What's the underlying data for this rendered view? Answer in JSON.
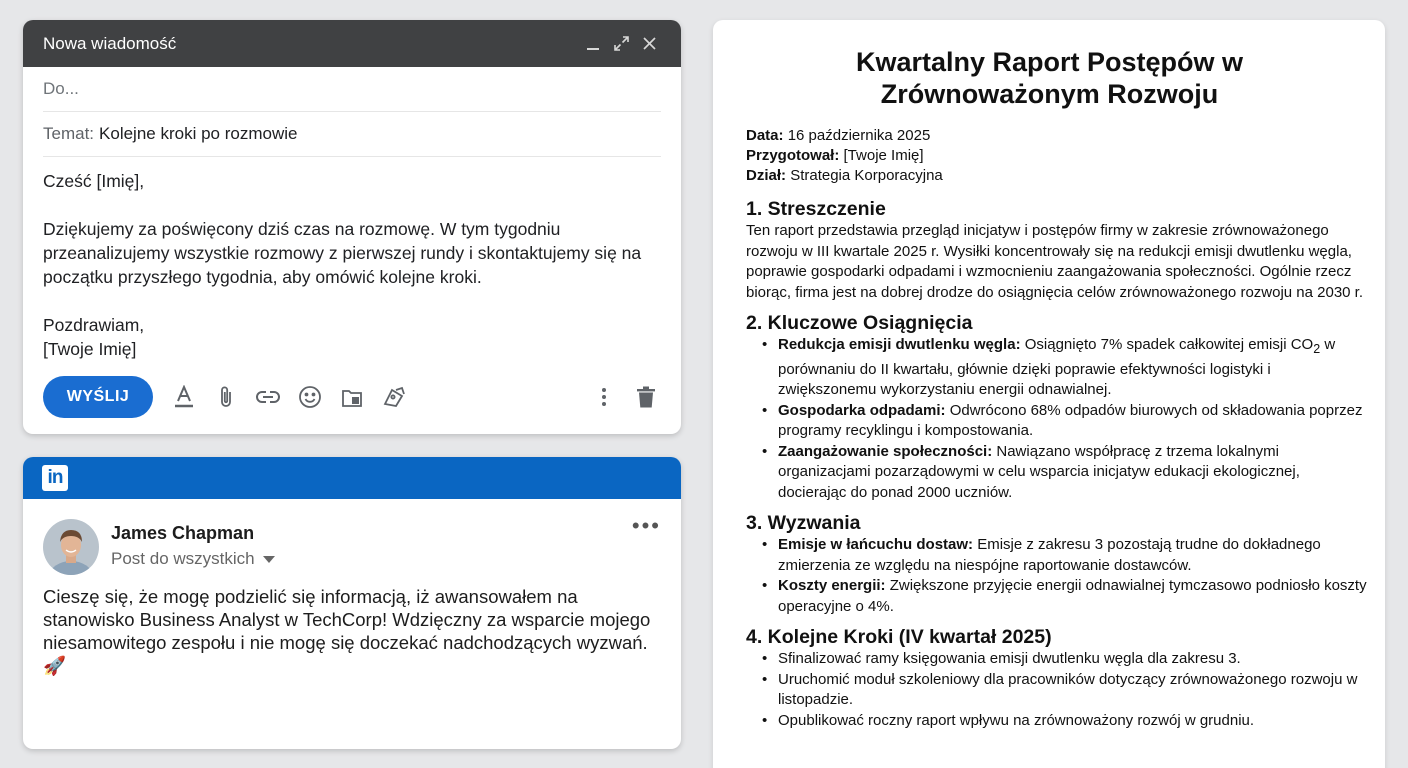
{
  "compose": {
    "title": "Nowa wiadomość",
    "to_placeholder": "Do...",
    "subject_label": "Temat:",
    "subject_value": "Kolejne kroki po rozmowie",
    "greeting": "Cześć [Imię],",
    "body": "Dziękujemy za poświęcony dziś czas na rozmowę. W tym tygodniu przeanalizujemy wszystkie rozmowy z pierwszej rundy i skontaktujemy się na początku przyszłego tygodnia, aby omówić kolejne kroki.",
    "closing": "Pozdrawiam,",
    "signature": "[Twoje Imię]",
    "send_label": "WYŚLIJ",
    "icons": [
      "format-text-icon",
      "attach-icon",
      "link-icon",
      "emoji-icon",
      "drive-icon",
      "photo-icon",
      "more-options-icon",
      "trash-icon"
    ]
  },
  "linkedin": {
    "logo": "in",
    "author": "James Chapman",
    "audience": "Post do wszystkich",
    "text": "Cieszę się, że mogę podzielić się informacją, iż awansowałem na stanowisko Business Analyst w TechCorp! Wdzięczny za wsparcie mojego niesamowitego zespołu i nie mogę się doczekać nadchodzących wyzwań. 🚀",
    "brand_color": "#0a66c2"
  },
  "report": {
    "title": "Kwartalny Raport Postępów w Zrównoważonym Rozwoju",
    "meta": [
      {
        "label": "Data:",
        "value": "16 października 2025"
      },
      {
        "label": "Przygotował:",
        "value": "[Twoje Imię]"
      },
      {
        "label": "Dział:",
        "value": "Strategia Korporacyjna"
      }
    ],
    "s1_heading": "1. Streszczenie",
    "s1_text": "Ten raport przedstawia przegląd inicjatyw i postępów firmy w zakresie zrównoważonego rozwoju w III kwartale 2025 r. Wysiłki koncentrowały się na redukcji emisji dwutlenku węgla, poprawie gospodarki odpadami i wzmocnieniu zaangażowania społeczności. Ogólnie rzecz biorąc, firma jest na dobrej drodze do osiągnięcia celów zrównoważonego rozwoju na 2030 r.",
    "s2_heading": "2. Kluczowe Osiągnięcia",
    "s2_items": [
      {
        "bold": "Redukcja emisji dwutlenku węgla:",
        "text_pre": " Osiągnięto 7% spadek całkowitej emisji CO",
        "sub": "2",
        "text_post": " w porównaniu do II kwartału, głównie dzięki poprawie efektywności logistyki i zwiększonemu wykorzystaniu energii odnawialnej."
      },
      {
        "bold": "Gospodarka odpadami:",
        "text_pre": " Odwrócono 68% odpadów biurowych od składowania poprzez programy recyklingu i kompostowania.",
        "sub": "",
        "text_post": ""
      },
      {
        "bold": "Zaangażowanie społeczności:",
        "text_pre": " Nawiązano współpracę z trzema lokalnymi organizacjami pozarządowymi w celu wsparcia inicjatyw edukacji ekologicznej, docierając do ponad 2000 uczniów.",
        "sub": "",
        "text_post": ""
      }
    ],
    "s3_heading": "3. Wyzwania",
    "s3_items": [
      {
        "bold": "Emisje w łańcuchu dostaw:",
        "text": " Emisje z zakresu 3 pozostają trudne do dokładnego zmierzenia ze względu na niespójne raportowanie dostawców."
      },
      {
        "bold": "Koszty energii:",
        "text": " Zwiększone przyjęcie energii odnawialnej tymczasowo podniosło koszty operacyjne o 4%."
      }
    ],
    "s4_heading": "4. Kolejne Kroki (IV kwartał 2025)",
    "s4_items": [
      "Sfinalizować ramy księgowania emisji dwutlenku węgla dla zakresu 3.",
      "Uruchomić moduł szkoleniowy dla pracowników dotyczący zrównoważonego rozwoju w listopadzie.",
      "Opublikować roczny raport wpływu na zrównoważony rozwój w grudniu."
    ]
  }
}
